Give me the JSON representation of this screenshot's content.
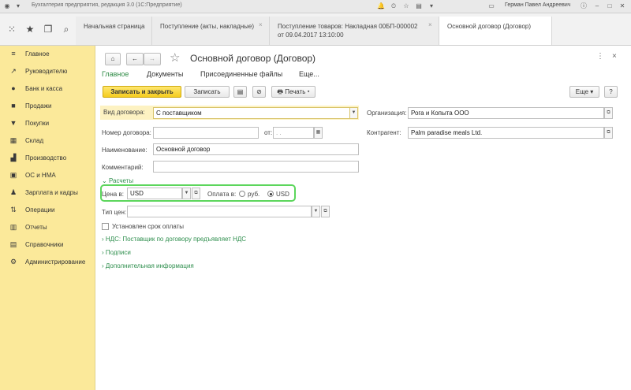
{
  "titlebar": {
    "title": "Бухгалтерия предприятия, редакция 3.0  (1С:Предприятие)",
    "user": "Герман Павел Андреевич"
  },
  "tabs": [
    {
      "label": "Начальная страница"
    },
    {
      "label": "Поступление (акты, накладные)"
    },
    {
      "label": "Поступление товаров: Накладная 00БП-000002",
      "label2": "от 09.04.2017 13:10:00"
    },
    {
      "label": "Основной договор (Договор)"
    }
  ],
  "sidebar": {
    "items": [
      {
        "label": "Главное",
        "icon": "menu-lines-icon"
      },
      {
        "label": "Руководителю",
        "icon": "trend-icon"
      },
      {
        "label": "Банк и касса",
        "icon": "coins-icon"
      },
      {
        "label": "Продажи",
        "icon": "bag-icon"
      },
      {
        "label": "Покупки",
        "icon": "cart-icon"
      },
      {
        "label": "Склад",
        "icon": "warehouse-icon"
      },
      {
        "label": "Производство",
        "icon": "factory-icon"
      },
      {
        "label": "ОС и НМА",
        "icon": "assets-icon"
      },
      {
        "label": "Зарплата и кадры",
        "icon": "people-icon"
      },
      {
        "label": "Операции",
        "icon": "operations-icon"
      },
      {
        "label": "Отчеты",
        "icon": "chart-icon"
      },
      {
        "label": "Справочники",
        "icon": "book-icon"
      },
      {
        "label": "Администрирование",
        "icon": "gear-icon"
      }
    ]
  },
  "form": {
    "title": "Основной договор (Договор)",
    "subtabs": [
      "Главное",
      "Документы",
      "Присоединенные файлы",
      "Еще..."
    ],
    "toolbar": {
      "save_close": "Записать и закрыть",
      "save": "Записать",
      "print": "Печать",
      "more": "Еще",
      "help": "?"
    },
    "contract_type": {
      "label": "Вид договора:",
      "value": "С поставщиком"
    },
    "contract_number": {
      "label": "Номер договора:",
      "value": ""
    },
    "date": {
      "label": "от:",
      "placeholder": " .  .  "
    },
    "name": {
      "label": "Наименование:",
      "value": "Основной договор"
    },
    "comment": {
      "label": "Комментарий:",
      "value": ""
    },
    "organization": {
      "label": "Организация:",
      "value": "Рога и Копыта ООО"
    },
    "counterparty": {
      "label": "Контрагент:",
      "value": "Palm paradise meals Ltd."
    },
    "settlements": "Расчеты",
    "price_in": {
      "label": "Цена в:",
      "value": "USD"
    },
    "pay_in": {
      "label": "Оплата в:",
      "opt1": "руб.",
      "opt2": "USD",
      "selected": "USD"
    },
    "price_type": {
      "label": "Тип цен:",
      "value": ""
    },
    "payment_term": "Установлен срок оплаты",
    "vat": "НДС: Поставщик по договору предъявляет НДС",
    "signatures": "Подписи",
    "additional": "Дополнительная информация"
  },
  "colors": {
    "sidebar": "#fbe99a",
    "primary": "#f5cc1e",
    "link": "#2f8f4e",
    "highlight": "#5cd65c"
  }
}
